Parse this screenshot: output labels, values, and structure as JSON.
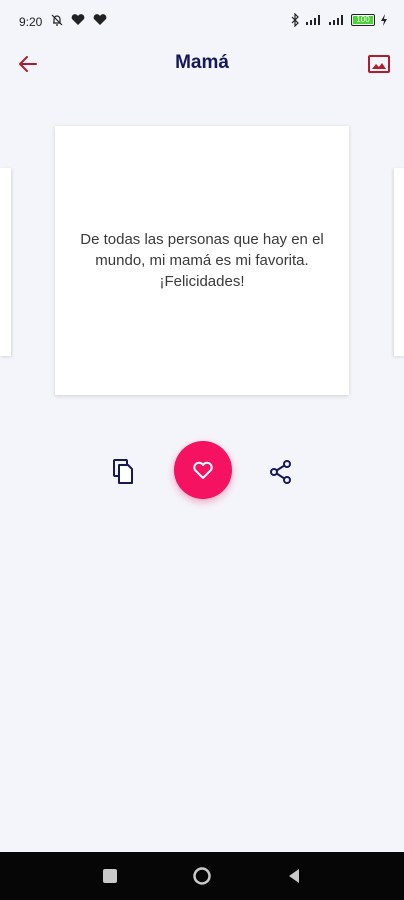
{
  "status_bar": {
    "time": "9:20",
    "battery": "100",
    "left_icons": [
      "notifications-off-icon",
      "heart-icon",
      "heart-icon"
    ],
    "right_icons": [
      "bluetooth-icon",
      "signal-icon",
      "signal-icon",
      "battery-icon",
      "charging-icon"
    ]
  },
  "header": {
    "title": "Mamá",
    "back_icon": "arrow-left-icon",
    "action_icon": "image-icon",
    "accent_color": "#b01e2d"
  },
  "card": {
    "quote": "De todas las personas que hay en el mundo, mi mamá es mi favorita. ¡Felicidades!"
  },
  "actions": {
    "copy_icon": "copy-icon",
    "favorite_icon": "heart-icon",
    "favorite_color": "#f51260",
    "share_icon": "share-icon"
  },
  "nav_bar": {
    "items": [
      "recents-icon",
      "home-icon",
      "back-icon"
    ]
  }
}
